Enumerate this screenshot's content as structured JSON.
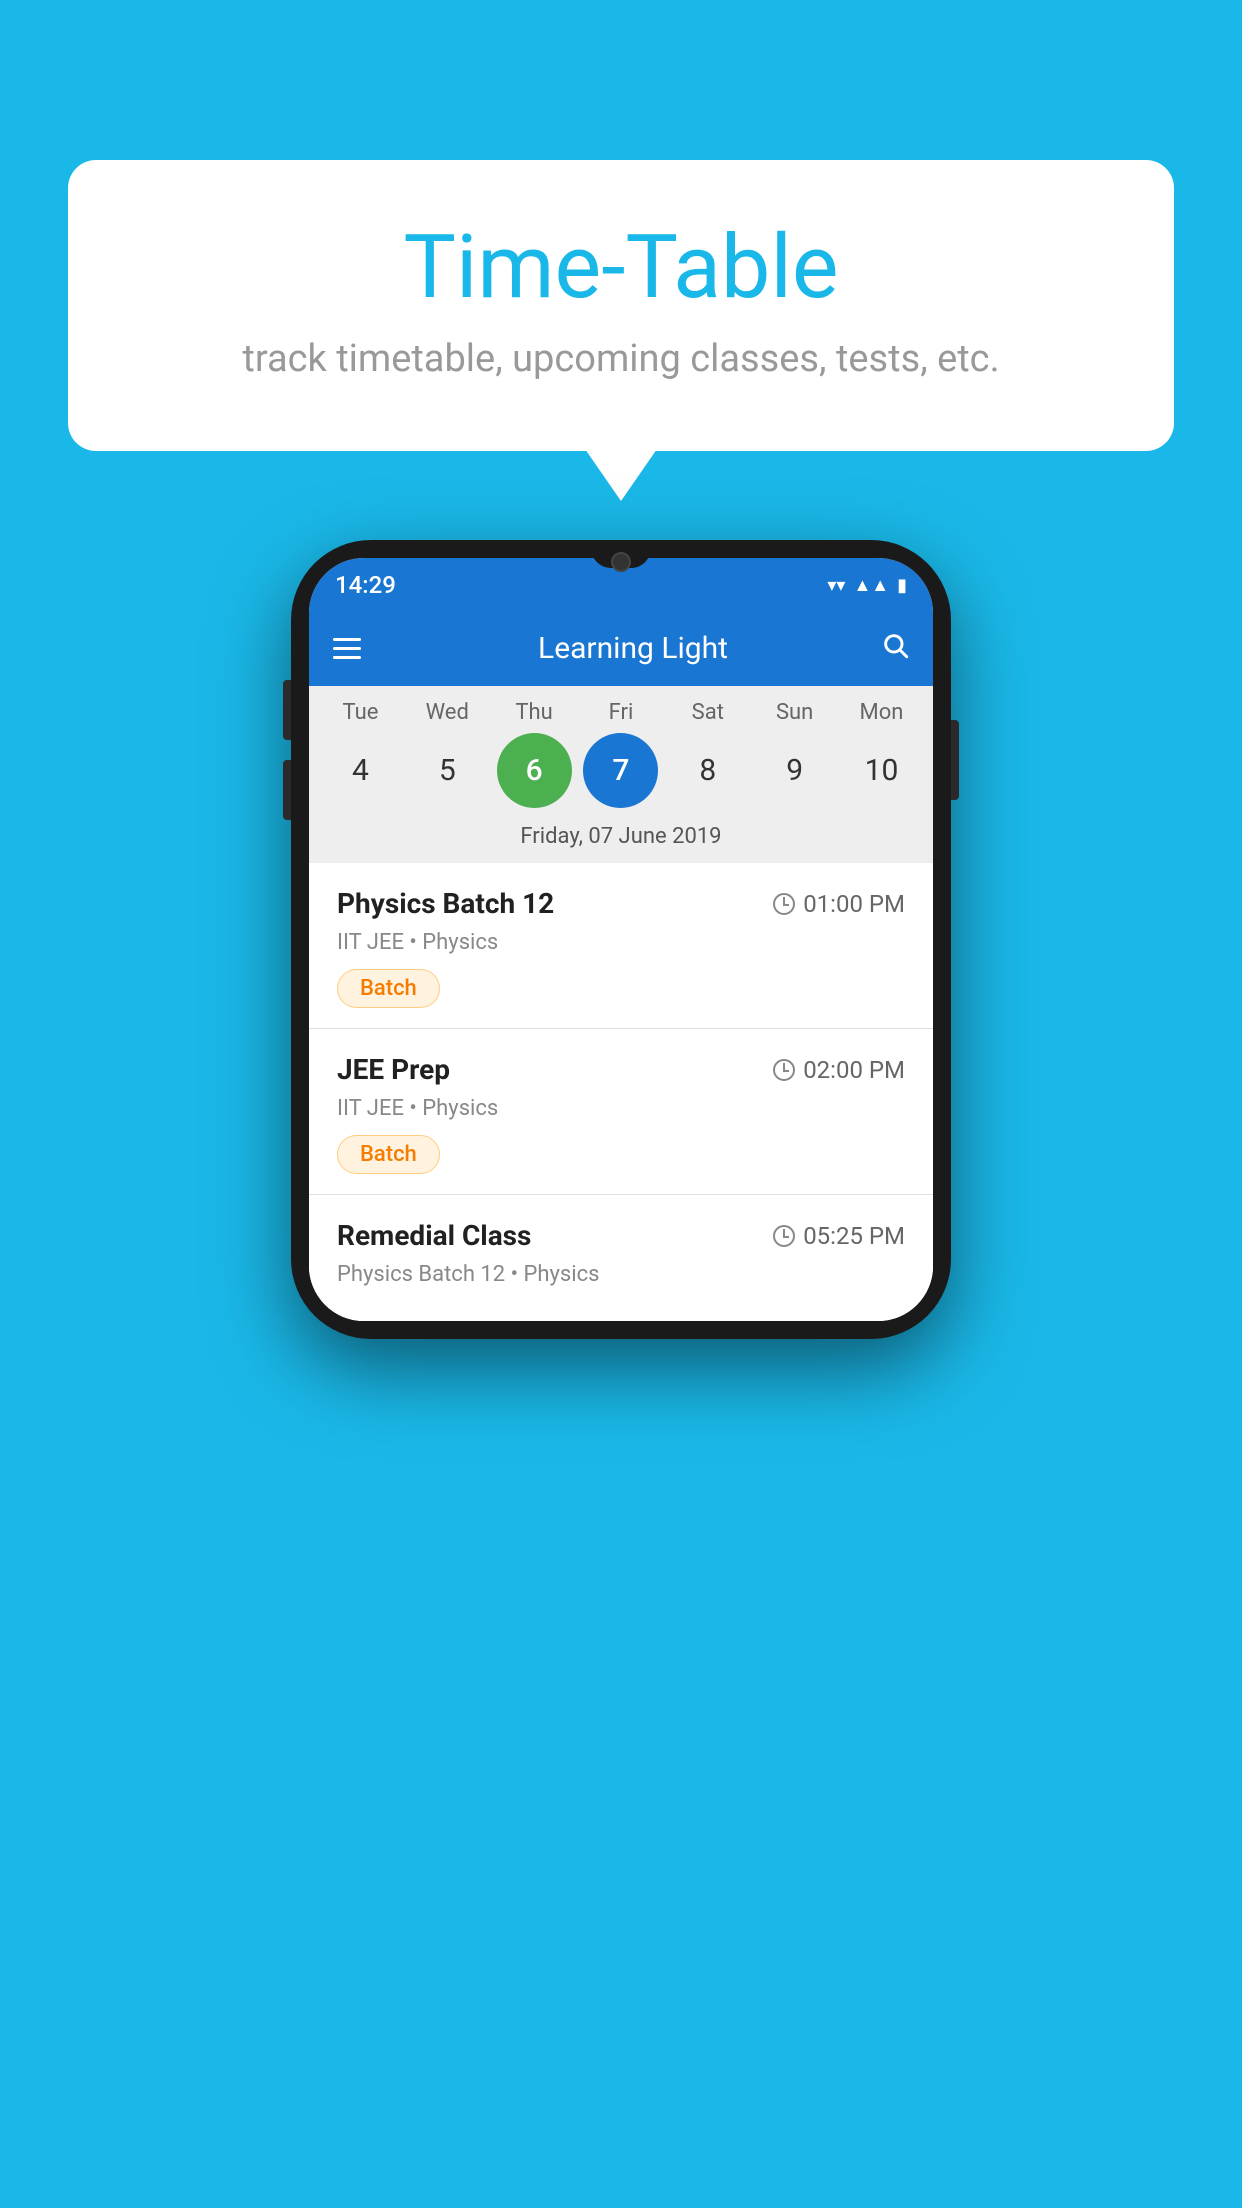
{
  "background_color": "#1ab8e8",
  "bubble": {
    "title": "Time-Table",
    "subtitle": "track timetable, upcoming classes, tests, etc."
  },
  "phone": {
    "status_bar": {
      "time": "14:29"
    },
    "app_bar": {
      "title": "Learning Light"
    },
    "calendar": {
      "days_of_week": [
        "Tue",
        "Wed",
        "Thu",
        "Fri",
        "Sat",
        "Sun",
        "Mon"
      ],
      "dates": [
        4,
        5,
        6,
        7,
        8,
        9,
        10
      ],
      "today_index": 2,
      "selected_index": 3,
      "selected_label": "Friday, 07 June 2019"
    },
    "events": [
      {
        "name": "Physics Batch 12",
        "time": "01:00 PM",
        "subject": "IIT JEE • Physics",
        "badge": "Batch"
      },
      {
        "name": "JEE Prep",
        "time": "02:00 PM",
        "subject": "IIT JEE • Physics",
        "badge": "Batch"
      },
      {
        "name": "Remedial Class",
        "time": "05:25 PM",
        "subject": "Physics Batch 12 • Physics",
        "badge": null
      }
    ]
  }
}
